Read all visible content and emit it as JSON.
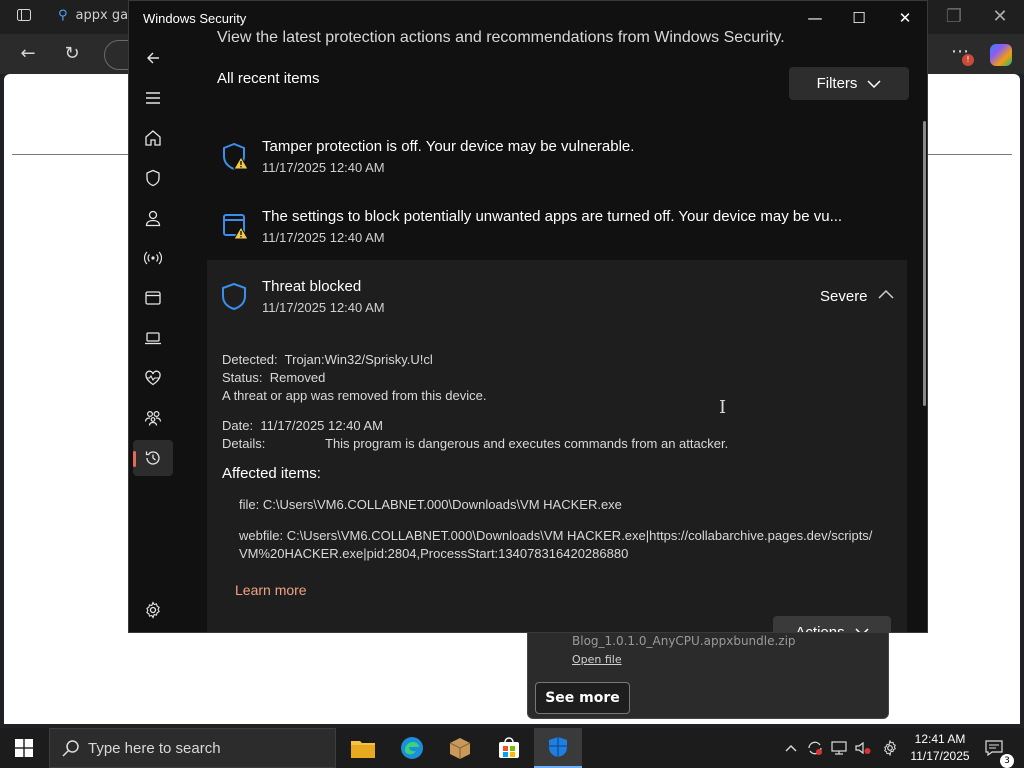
{
  "browser": {
    "tab_title": "appx ga",
    "colors": {
      "tabbar": "#1f1f1f",
      "toolbar": "#2b2b2b",
      "page": "#ffffff"
    }
  },
  "window": {
    "title": "Windows Security",
    "controls": [
      "minimize-icon",
      "maximize-icon",
      "close-icon"
    ]
  },
  "nav": {
    "items": [
      {
        "name": "home",
        "icon": "home-icon"
      },
      {
        "name": "virus-threat-protection",
        "icon": "shield-icon"
      },
      {
        "name": "account-protection",
        "icon": "person-icon"
      },
      {
        "name": "firewall-network",
        "icon": "antenna-icon"
      },
      {
        "name": "app-browser-control",
        "icon": "app-window-icon"
      },
      {
        "name": "device-security",
        "icon": "laptop-icon"
      },
      {
        "name": "device-performance-health",
        "icon": "heart-pulse-icon"
      },
      {
        "name": "family-options",
        "icon": "family-icon"
      },
      {
        "name": "protection-history",
        "icon": "history-icon",
        "selected": true
      }
    ],
    "settings_icon": "gear-icon"
  },
  "main": {
    "header_text": "View the latest protection actions and recommendations from Windows Security.",
    "section_title": "All recent items",
    "filters_label": "Filters",
    "items": [
      {
        "title": "Tamper protection is off. Your device may be vulnerable.",
        "date": "11/17/2025 12:40 AM",
        "icon": "shield-warning-icon"
      },
      {
        "title": "The settings to block potentially unwanted apps are turned off. Your device may be vu...",
        "date": "11/17/2025 12:40 AM",
        "icon": "app-window-warning-icon"
      }
    ],
    "threat": {
      "title": "Threat blocked",
      "date": "11/17/2025 12:40 AM",
      "severity": "Severe",
      "detected_label": "Detected:",
      "detected_value": "Trojan:Win32/Sprisky.U!cl",
      "status_label": "Status:",
      "status_value": "Removed",
      "status_note": "A threat or app was removed from this device.",
      "date_label": "Date:",
      "date_value": "11/17/2025 12:40 AM",
      "details_label": "Details:",
      "details_value": "This program is dangerous and executes commands from an attacker.",
      "affected_title": "Affected items:",
      "affected": [
        "file: C:\\Users\\VM6.COLLABNET.000\\Downloads\\VM HACKER.exe",
        "webfile: C:\\Users\\VM6.COLLABNET.000\\Downloads\\VM HACKER.exe|https://collabarchive.pages.dev/scripts/VM%20HACKER.exe|pid:2804,ProcessStart:134078316420286880"
      ],
      "learn_more": "Learn more",
      "actions_label": "Actions"
    }
  },
  "downloads": {
    "file_name": "Blog_1.0.1.0_AnyCPU.appxbundle.zip",
    "open_file": "Open file",
    "see_more": "See more"
  },
  "taskbar": {
    "search_placeholder": "Type here to search",
    "apps": [
      "file-explorer-icon",
      "edge-icon",
      "package-icon",
      "store-icon",
      "windows-security-icon"
    ],
    "time": "12:41 AM",
    "date": "11/17/2025",
    "notification_count": "3"
  },
  "colors": {
    "accent": "#3b8eea",
    "warning": "#f2c94c",
    "learn_more": "#f0a383",
    "selected_indicator": "#e06c55"
  }
}
